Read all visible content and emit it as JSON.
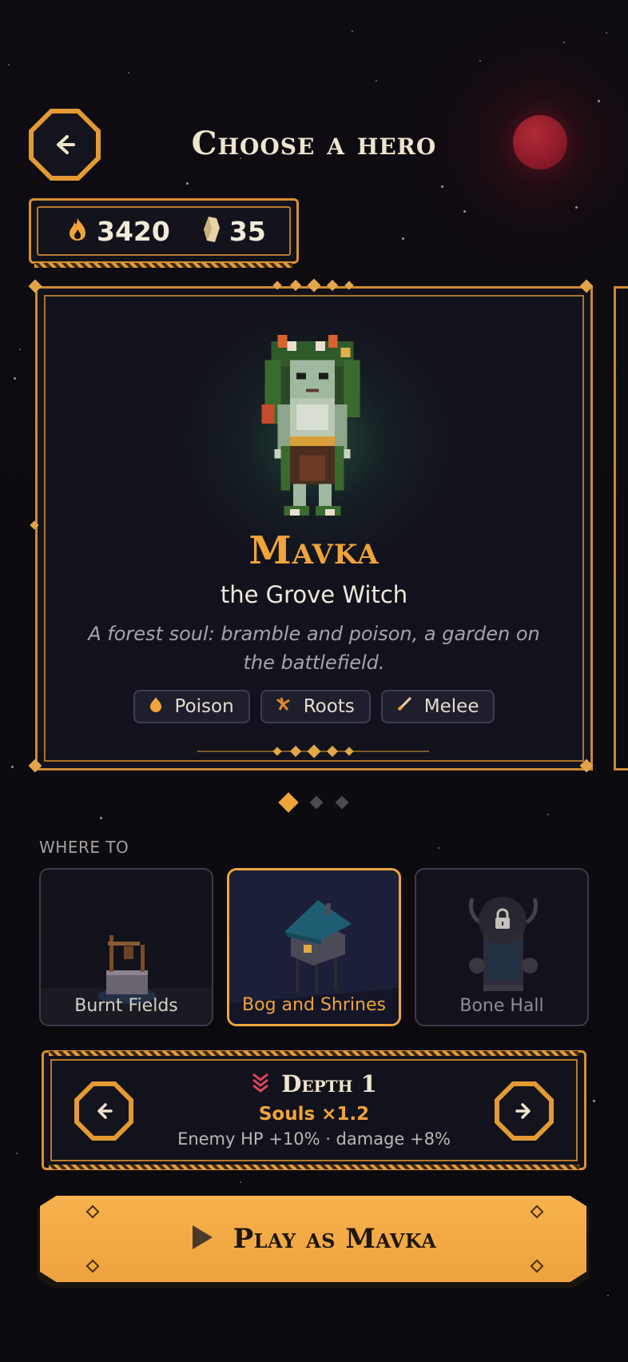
{
  "screen": {
    "title": "Choose a hero",
    "back_icon": "arrow-left-icon"
  },
  "currency": {
    "flames": "3420",
    "flame_icon": "flame-icon",
    "crystals": "35",
    "crystal_icon": "crystal-icon"
  },
  "hero": {
    "name": "Mavka",
    "subtitle": "the Grove Witch",
    "description": "A forest soul: bramble and poison, a garden on the battlefield.",
    "tags": [
      {
        "label": "Poison",
        "icon": "poison-drop-icon"
      },
      {
        "label": "Roots",
        "icon": "roots-icon"
      },
      {
        "label": "Melee",
        "icon": "dagger-icon"
      }
    ]
  },
  "carousel": {
    "count": 3,
    "active_index": 0
  },
  "where_to": {
    "label": "WHERE TO",
    "destinations": [
      {
        "name": "Burnt Fields",
        "selected": false,
        "locked": false
      },
      {
        "name": "Bog and Shrines",
        "selected": true,
        "locked": false
      },
      {
        "name": "Bone Hall",
        "selected": false,
        "locked": true
      }
    ]
  },
  "depth": {
    "title": "Depth 1",
    "multiplier": "Souls ×1.2",
    "modifiers": "Enemy HP +10% · damage +8%"
  },
  "play_button": {
    "label": "Play as Mavka"
  },
  "colors": {
    "accent": "#f0a43a",
    "frame": "#d98f2f",
    "panel": "#12121c",
    "background": "#0d0b10",
    "moon": "#9e2230"
  }
}
